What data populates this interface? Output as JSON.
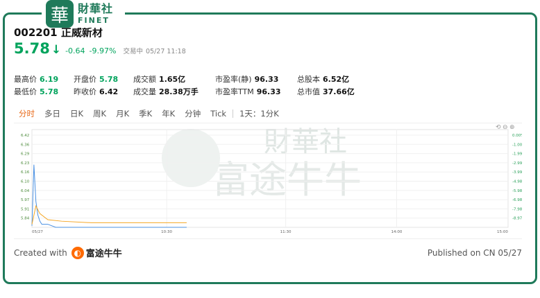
{
  "site": {
    "logo_glyph": "華",
    "logo_cn": "財華社",
    "logo_en": "FINET"
  },
  "stock": {
    "code_name": "002201 正威新材",
    "price": "5.78",
    "change": "-0.64",
    "change_pct": "-9.97%",
    "status": "交易中",
    "time": "05/27 11:18"
  },
  "stats": {
    "high": {
      "label": "最高价",
      "value": "6.19"
    },
    "open": {
      "label": "开盘价",
      "value": "5.78"
    },
    "turnover": {
      "label": "成交额",
      "value": "1.65亿"
    },
    "pe_static": {
      "label": "市盈率(静)",
      "value": "96.33"
    },
    "total_shares": {
      "label": "总股本",
      "value": "6.52亿"
    },
    "low": {
      "label": "最低价",
      "value": "5.78"
    },
    "prev_close": {
      "label": "昨收价",
      "value": "6.42"
    },
    "volume": {
      "label": "成交量",
      "value": "28.38万手"
    },
    "pe_ttm": {
      "label": "市盈率TTM",
      "value": "96.33"
    },
    "market_cap": {
      "label": "总市值",
      "value": "37.66亿"
    }
  },
  "tabs": [
    "分时",
    "多日",
    "日K",
    "周K",
    "月K",
    "季K",
    "年K",
    "分钟",
    "Tick",
    "1天：1分K"
  ],
  "watermark": {
    "text1": "財華社",
    "text2": "富途牛牛"
  },
  "chart_data": {
    "type": "line",
    "y_ticks": [
      "6.42",
      "6.36",
      "6.29",
      "6.23",
      "6.16",
      "6.10",
      "6.04",
      "5.97",
      "5.91",
      "5.84"
    ],
    "pct_ticks": [
      "0.00%",
      "-1.00%",
      "-1.99%",
      "-2.99%",
      "-3.99%",
      "-4.98%",
      "-5.98%",
      "-6.98%",
      "-7.98%",
      "-8.97%"
    ],
    "x_ticks": [
      "05/27",
      "10:30",
      "11:30",
      "14:00",
      "15:00"
    ],
    "ylim": [
      5.78,
      6.42
    ],
    "series": [
      {
        "color": "#4a90e2",
        "x": [
          0,
          1,
          2,
          3,
          4,
          5,
          8,
          12,
          20,
          40,
          78
        ],
        "values": [
          5.79,
          6.19,
          5.95,
          5.86,
          5.82,
          5.8,
          5.8,
          5.78,
          5.78,
          5.78,
          5.78
        ]
      },
      {
        "color": "#f5a623",
        "x": [
          0,
          2,
          4,
          8,
          15,
          30,
          50,
          78
        ],
        "values": [
          5.8,
          5.92,
          5.87,
          5.83,
          5.82,
          5.81,
          5.81,
          5.81
        ]
      }
    ]
  },
  "footer": {
    "created_with": "Created with",
    "brand": "富途牛牛",
    "published": "Published on CN 05/27"
  }
}
